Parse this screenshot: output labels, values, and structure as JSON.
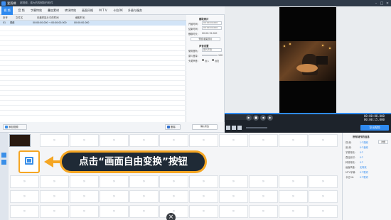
{
  "app": {
    "name": "爱剪辑",
    "document_title": "超视频、强大的视频制作软件"
  },
  "menu": {
    "items": [
      "视 频",
      "音 频",
      "字幕特效",
      "叠加素材",
      "转场特效",
      "画面风格",
      "M T V",
      "卡拉OK",
      "升级与服务"
    ],
    "active_index": 0
  },
  "video_list": {
    "columns": [
      "序号",
      "文件名",
      "在最终影片中的时间",
      "截取时长"
    ],
    "rows": [
      {
        "index": "01",
        "name": "视频",
        "time": "00:00:00.000 → 00:00:00.000",
        "duration": "00:00:00.000"
      }
    ],
    "add_button": "添加视频",
    "delete_button": "删除"
  },
  "settings": {
    "clip_title": "截取原片",
    "start_label": "开始时间:",
    "start_value": "00:00:00.000",
    "end_label": "结束时间:",
    "end_value": "00:00:00.000",
    "duration_label": "截取时长:",
    "duration_value": "00:00:15.000",
    "preview_button": "预览/截取原片",
    "audio_title": "声音设置",
    "track_label": "使用音轨:",
    "track_value": "原片声音",
    "volume_label": "原片音量:",
    "volume_value": "100",
    "head_tail_label": "头尾声音:",
    "fade_in": "淡入",
    "fade_out": "淡出",
    "confirm_button": "确认修改"
  },
  "player": {
    "current_time": "00:00:00.000",
    "total_time": "00:00:15.000",
    "export_button": "导出视频"
  },
  "right_panel": {
    "title": "所有制作的信息",
    "rows": [
      {
        "label": "视  频:",
        "value": "1个视频"
      },
      {
        "label": "音  频:",
        "value": "0个音频"
      },
      {
        "label": "字幕特效:",
        "value": "0个"
      },
      {
        "label": "叠加素材:",
        "value": "0个"
      },
      {
        "label": "转场特效:",
        "value": "0个"
      },
      {
        "label": "画面风格:",
        "value": "无特效"
      },
      {
        "label": "MTV字幕:",
        "value": "0个歌词"
      },
      {
        "label": "卡拉OK:",
        "value": "0个歌词"
      }
    ],
    "detail_button": "详细"
  },
  "callout": {
    "text": "点击“画面自由变换”按钮"
  },
  "timeline": {
    "close_icon": "×"
  },
  "colors": {
    "accent": "#2f8af0",
    "callout_border": "#f5a623",
    "callout_fill": "#1f2a36",
    "titlebar": "#2f3a48"
  },
  "icons": {
    "transform": "free-transform-icon",
    "add": "add-video-icon",
    "delete": "delete-icon",
    "close": "close-icon"
  }
}
